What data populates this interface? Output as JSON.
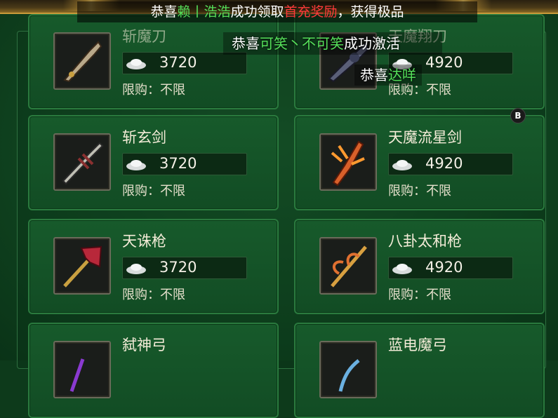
{
  "ticker": {
    "prefix": "恭喜",
    "player": "赖丨浩浩",
    "middle": "成功领取",
    "reward": "首充奖励",
    "suffix": "，获得极品"
  },
  "notice1": {
    "prefix": "恭喜",
    "player": "可笑丶不可笑",
    "suffix": "成功激活"
  },
  "notice2": {
    "prefix": "恭喜",
    "player": "达咩"
  },
  "badge": "B",
  "items": [
    {
      "name": "斩魔刀",
      "price": "3720",
      "limit": "限购：不限"
    },
    {
      "name": "天魔翔刀",
      "price": "4920",
      "limit": "限购：不限"
    },
    {
      "name": "斩玄剑",
      "price": "3720",
      "limit": "限购：不限"
    },
    {
      "name": "天魔流星剑",
      "price": "4920",
      "limit": "限购：不限"
    },
    {
      "name": "天诛枪",
      "price": "3720",
      "limit": "限购：不限"
    },
    {
      "name": "八卦太和枪",
      "price": "4920",
      "limit": "限购：不限"
    },
    {
      "name": "弑神弓",
      "price": "",
      "limit": ""
    },
    {
      "name": "蓝电魔弓",
      "price": "",
      "limit": ""
    }
  ],
  "icons": {
    "currency": "silver-ingot-icon",
    "weapons": [
      "saber-icon",
      "dark-saber-icon",
      "sword-icon",
      "flame-sword-icon",
      "spear-icon",
      "gold-spear-icon",
      "bow-icon",
      "blue-bow-icon"
    ]
  }
}
